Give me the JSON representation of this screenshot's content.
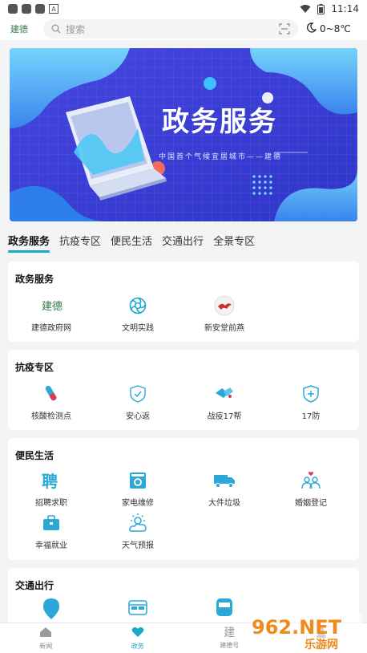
{
  "status_bar": {
    "time": "11:14"
  },
  "header": {
    "logo_text": "建德",
    "search_placeholder": "搜索",
    "weather": "0~8℃"
  },
  "banner": {
    "title": "政务服务",
    "subtitle": "中国首个气候宜居城市——建德"
  },
  "tabs": [
    "政务服务",
    "抗疫专区",
    "便民生活",
    "交通出行",
    "全景专区"
  ],
  "sections": {
    "gov": {
      "title": "政务服务",
      "items": [
        {
          "label": "建德政府网",
          "icon": "jiande-logo-icon"
        },
        {
          "label": "文明实践",
          "icon": "flower-icon"
        },
        {
          "label": "新安堂前燕",
          "icon": "swallow-logo-icon"
        }
      ]
    },
    "epidemic": {
      "title": "抗疫专区",
      "items": [
        {
          "label": "核酸检测点",
          "icon": "test-tube-icon"
        },
        {
          "label": "安心返",
          "icon": "shield-check-icon"
        },
        {
          "label": "战疫17帮",
          "icon": "handshake-icon"
        },
        {
          "label": "17防",
          "icon": "medical-shield-icon"
        }
      ]
    },
    "life": {
      "title": "便民生活",
      "items": [
        {
          "label": "招聘求职",
          "icon": "recruit-icon"
        },
        {
          "label": "家电维修",
          "icon": "appliance-icon"
        },
        {
          "label": "大件垃圾",
          "icon": "truck-icon"
        },
        {
          "label": "婚姻登记",
          "icon": "couple-icon"
        },
        {
          "label": "幸福就业",
          "icon": "briefcase-icon"
        },
        {
          "label": "天气预报",
          "icon": "weather-icon"
        }
      ]
    },
    "traffic": {
      "title": "交通出行",
      "items": [
        {
          "label": "",
          "icon": "location-pin-icon"
        },
        {
          "label": "",
          "icon": "bus-icon"
        },
        {
          "label": "",
          "icon": "train-icon"
        }
      ]
    }
  },
  "bottom_nav": [
    {
      "label": "新闻",
      "icon": "home-icon"
    },
    {
      "label": "政务",
      "icon": "heart-icon",
      "active": true
    },
    {
      "label": "建德号",
      "icon": "jian-char-icon"
    },
    {
      "label": "我的",
      "icon": "user-icon"
    }
  ],
  "watermark": {
    "brand": "962.NET",
    "subtitle": "乐游网"
  },
  "colors": {
    "accent": "#19a9c6",
    "banner_bg": "#3a3fd6"
  }
}
